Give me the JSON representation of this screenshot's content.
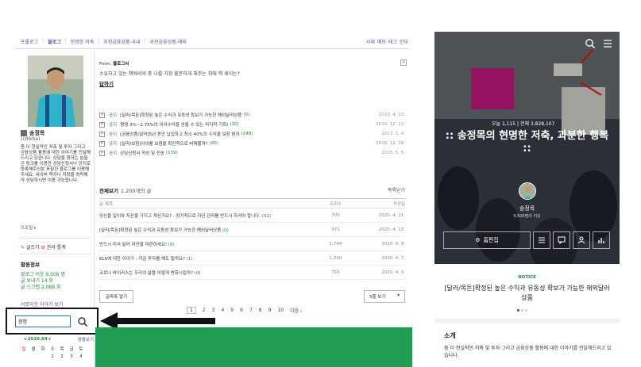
{
  "topnav": {
    "items": [
      "프롤로그",
      "블로그",
      "한명한 저축",
      "추천금융상품-국내",
      "추천금융상품-해외"
    ],
    "right": [
      "서재",
      "메모",
      "태그",
      "안부"
    ]
  },
  "profile": {
    "nickname": "송정목",
    "user_id": "(cdikha)",
    "description": "좀 더 현실적인 저축 및 투자 그리고 금융상품 활용에 대한 이야기를 전달해드리고 있습니다. 상담을 원하는 분들은 링크를 이용한 상담신청서나 공지로 등록해주신분 포함한 블로그를 이용해주세요. 네이버 쪽지나 저장을 허락해야 상담하시면 이용 가능합니다.",
    "prologue_link": "프로필 ▸",
    "write_label": "글쓰기",
    "manage_label": "관리·통계"
  },
  "stats": {
    "title": "활동정보",
    "lines": [
      "블로그 이웃 9,506 명",
      "글 보내기 14 회",
      "글 스크랩 2,088 회"
    ],
    "neighbor_link": "서로이웃 이야기 보기"
  },
  "search": {
    "value": "현명"
  },
  "calendar": {
    "month": "◂ 2020.04 ▸",
    "all_label": "월별보기",
    "days": [
      "일",
      "월",
      "화",
      "수",
      "목",
      "금",
      "토"
    ],
    "nums": [
      "",
      "",
      "",
      "1",
      "2",
      "3",
      "4"
    ]
  },
  "buddy": {
    "from_prefix": "From.",
    "from_name": "블로그씨",
    "message": "소유하고 있는 책에서의 중 나를 가장 흥분하게 해주는 최애 책 세이는?",
    "reply_label": "답하기",
    "close_glyph": "×"
  },
  "notices": [
    {
      "tag": "공지",
      "title": "[달러/목돈]확정된 높은 수익과 유동성 확보가 가능한 해외달러상품",
      "count": "(0)",
      "date": "2020. 4. 13."
    },
    {
      "tag": "공지",
      "title": "평생 3%~2.75%의 이자수익을 얻을 수 있는 마지막 기회!",
      "count": "(30)",
      "date": "2019. 12. 12."
    },
    {
      "tag": "공지",
      "title": "[금융상품/달러]5년 동안 납입하고 최소 40%의 수익을 보장 받자",
      "count": "(248)",
      "date": "2017. 1. 4."
    },
    {
      "tag": "공지",
      "title": "[달러/보험]아이를 보험을 확신적으로 바꿔볼까?",
      "count": "(40)",
      "date": "2018. 12. 26."
    },
    {
      "tag": "공지",
      "title": "상담신청서 작성 및 전송",
      "count": "(139)",
      "date": "2015. 5. 5."
    }
  ],
  "list": {
    "heading": "전체보기",
    "count": "1,200개의 글",
    "close_label": "목록닫기",
    "columns": [
      "글 제목",
      "조회수",
      "작성일"
    ],
    "rows": [
      {
        "title": "당신을 일이와 자산을 가지고 계신가요? - 장기적으로 자산 관리를 반드시 하셔야 합니다.",
        "count": "(31)",
        "views": "705",
        "date": "2020. 4. 21."
      },
      {
        "title": "[달러/목돈]확정된 높은 수익과 유동성 확보가 가능한 해외달러상품",
        "count": "(0)",
        "views": "971",
        "date": "2020. 4. 13."
      },
      {
        "title": "반드시 미국 달러 자산을 마련하세요!",
        "count": "(0)",
        "views": "1,744",
        "date": "2020. 4. 9."
      },
      {
        "title": "ELS에 대한 이야기 : 지금 투자를 해도 될까요?",
        "count": "(1)",
        "views": "1,330",
        "date": "2020. 4. 7."
      },
      {
        "title": "코로나 바이러스는 우리의 삶을 어떻게 변화시킬까?",
        "count": "(0)",
        "views": "755",
        "date": "2020. 4. 3."
      }
    ],
    "open_label": "글목록 열기",
    "per_page": "5줄 보기",
    "pages": [
      "1",
      "2",
      "3",
      "4",
      "5",
      "6",
      "7",
      "8",
      "9",
      "10"
    ],
    "next_label": "다음 ›"
  },
  "mobile": {
    "counter": "오늘 1,115  |  전체 3,828,107",
    "title": ":: 송정목의 현명한 저축, 과분한 행복 ::",
    "name": "송정목",
    "sub": "9,506명의 이웃",
    "edit_label": "홈편집",
    "notice_label": "NOTICE",
    "notice_title": "[달러/목돈]확정된 높은 수익과 유동성 확보가 가능한 해외달러상품",
    "intro_title": "소개",
    "intro_text": "좀 더 현실적인 저축 및 투자 그리고 금융상품 활용에 대한 이야기를 전달해드리고 있습니다."
  },
  "colors": {
    "accent_green": "#1f9d55",
    "link_purple": "#6a4aa5"
  },
  "icons": [
    "search-icon",
    "menu-icon",
    "gear-icon",
    "arrow-left-icon",
    "checkbox-icon"
  ]
}
